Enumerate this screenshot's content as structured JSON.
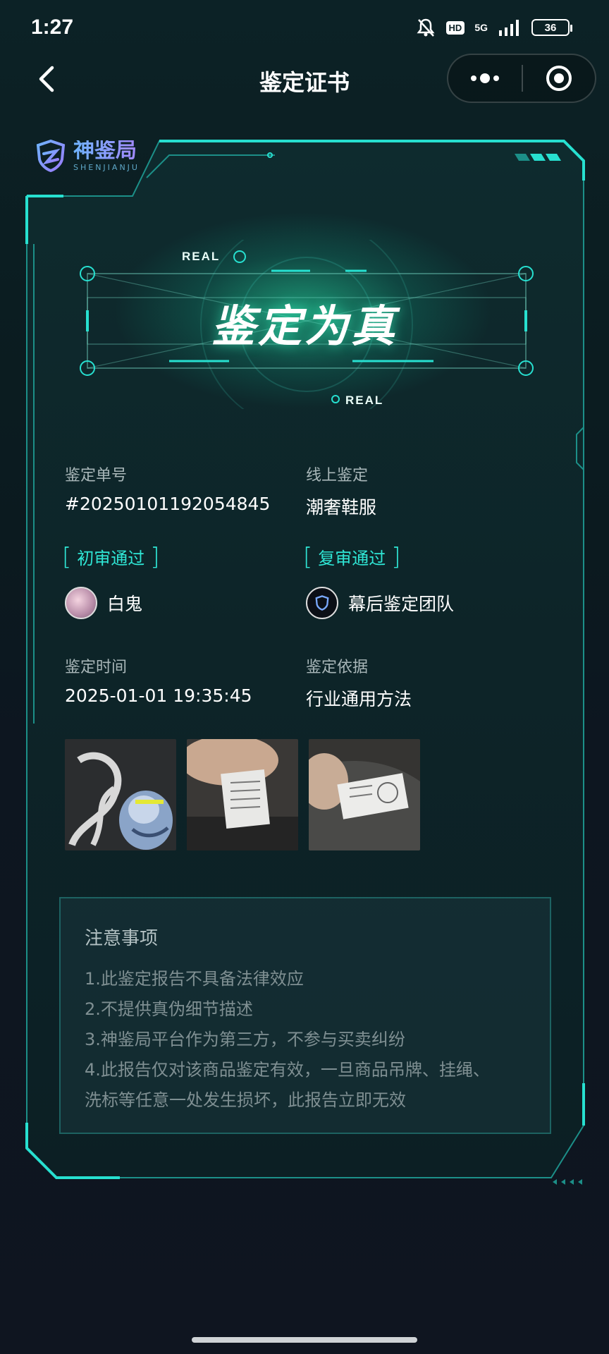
{
  "status_bar": {
    "time": "1:27",
    "hd_label": "HD",
    "network": "5G",
    "battery": "36"
  },
  "nav": {
    "title": "鉴定证书"
  },
  "logo": {
    "name": "神鉴局",
    "sub": "SHENJIANJU"
  },
  "hero": {
    "title": "鉴定为真",
    "tag_top": "REAL",
    "tag_bottom": "REAL"
  },
  "info": {
    "order_label": "鉴定单号",
    "order_value": "#20250101192054845",
    "type_label": "线上鉴定",
    "type_value": "潮奢鞋服",
    "first_review_label": "初审通过",
    "first_reviewer": "白鬼",
    "second_review_label": "复审通过",
    "second_reviewer": "幕后鉴定团队",
    "time_label": "鉴定时间",
    "time_value": "2025-01-01 19:35:45",
    "basis_label": "鉴定依据",
    "basis_value": "行业通用方法"
  },
  "notice": {
    "title": "注意事项",
    "lines": [
      "1.此鉴定报告不具备法律效应",
      "2.不提供真伪细节描述",
      "3.神鉴局平台作为第三方，不参与买卖纠纷",
      "4.此报告仅对该商品鉴定有效，一旦商品吊牌、挂绳、",
      "洗标等任意一处发生损坏，此报告立即无效"
    ]
  },
  "colors": {
    "accent": "#2fe6d5",
    "background": "#0b1a1f",
    "frame_border": "#1fd3c4"
  }
}
